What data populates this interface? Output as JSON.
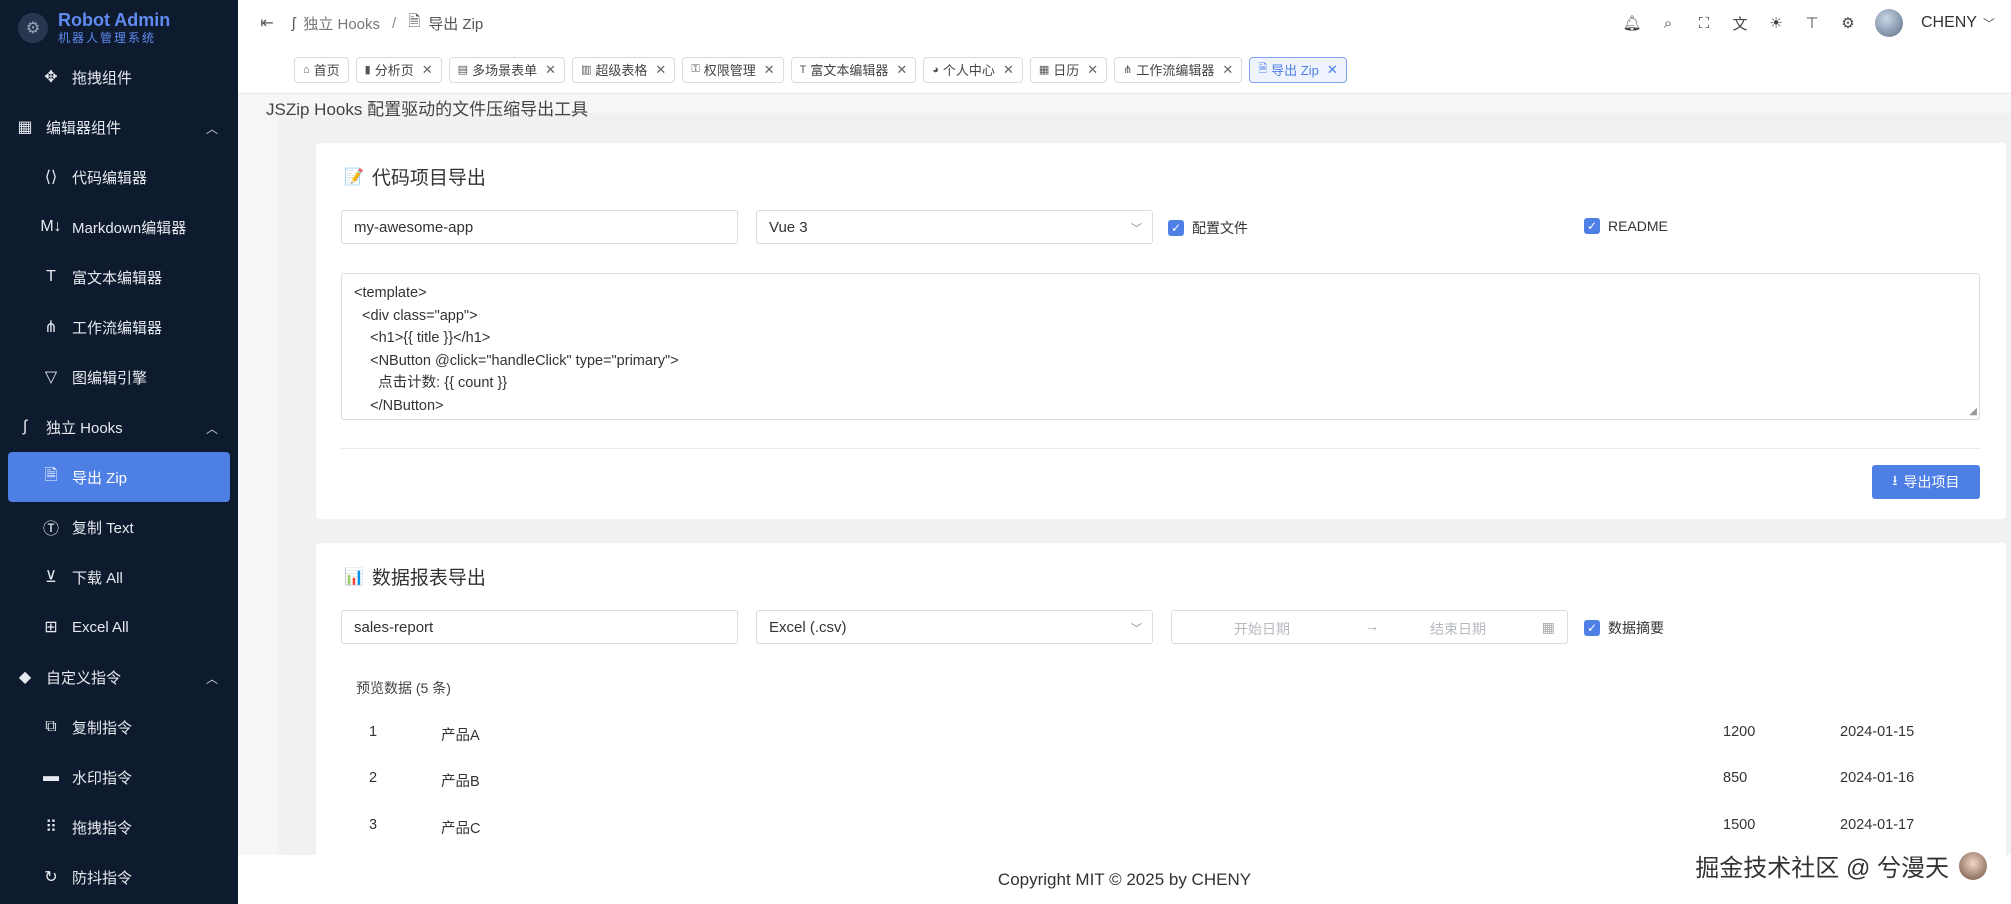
{
  "brand": {
    "title": "Robot Admin",
    "subtitle": "机器人管理系统"
  },
  "sidebar": {
    "items": [
      {
        "label": "拖拽组件",
        "icon": "drag-component-icon",
        "type": "child"
      },
      {
        "label": "编辑器组件",
        "icon": "editor-group-icon",
        "type": "group",
        "expanded": true
      },
      {
        "label": "代码编辑器",
        "icon": "vscode-icon",
        "type": "child"
      },
      {
        "label": "Markdown编辑器",
        "icon": "markdown-icon",
        "type": "child"
      },
      {
        "label": "富文本编辑器",
        "icon": "text-format-icon",
        "type": "child"
      },
      {
        "label": "工作流编辑器",
        "icon": "workflow-icon",
        "type": "child"
      },
      {
        "label": "图编辑引擎",
        "icon": "graph-engine-icon",
        "type": "child"
      },
      {
        "label": "独立 Hooks",
        "icon": "hook-icon",
        "type": "group",
        "expanded": true
      },
      {
        "label": "导出 Zip",
        "icon": "file-zip-icon",
        "type": "child",
        "active": true
      },
      {
        "label": "复制 Text",
        "icon": "text-circle-icon",
        "type": "child"
      },
      {
        "label": "下载 All",
        "icon": "download-circle-icon",
        "type": "child"
      },
      {
        "label": "Excel All",
        "icon": "excel-icon",
        "type": "child"
      },
      {
        "label": "自定义指令",
        "icon": "directive-icon",
        "type": "group",
        "expanded": true
      },
      {
        "label": "复制指令",
        "icon": "copy-icon",
        "type": "child"
      },
      {
        "label": "水印指令",
        "icon": "watermark-icon",
        "type": "child"
      },
      {
        "label": "拖拽指令",
        "icon": "drag-dots-icon",
        "type": "child"
      },
      {
        "label": "防抖指令",
        "icon": "debounce-icon",
        "type": "child"
      }
    ]
  },
  "header": {
    "breadcrumb": [
      "独立 Hooks",
      "导出 Zip"
    ],
    "username": "CHENY",
    "tools": [
      "bell-icon",
      "search-icon",
      "fullscreen-icon",
      "translate-icon",
      "theme-sun-icon",
      "layout-icon",
      "settings-icon"
    ]
  },
  "tabs": [
    {
      "label": "首页",
      "icon": "home-icon",
      "closable": false
    },
    {
      "label": "分析页",
      "icon": "chart-icon",
      "closable": true
    },
    {
      "label": "多场景表单",
      "icon": "form-icon",
      "closable": true
    },
    {
      "label": "超级表格",
      "icon": "table-icon",
      "closable": true
    },
    {
      "label": "权限管理",
      "icon": "key-icon",
      "closable": true
    },
    {
      "label": "富文本编辑器",
      "icon": "text-format-icon",
      "closable": true
    },
    {
      "label": "个人中心",
      "icon": "user-icon",
      "closable": true
    },
    {
      "label": "日历",
      "icon": "calendar-icon",
      "closable": true
    },
    {
      "label": "工作流编辑器",
      "icon": "workflow-icon",
      "closable": true
    },
    {
      "label": "导出 Zip",
      "icon": "file-zip-icon",
      "closable": true,
      "active": true
    }
  ],
  "page": {
    "clipped_intro": "JSZip Hooks 配置驱动的文件压缩导出工具"
  },
  "code_card": {
    "title": "代码项目导出",
    "emoji": "📝",
    "project_name": "my-awesome-app",
    "framework": "Vue 3",
    "checkbox_config": "配置文件",
    "checkbox_readme": "README",
    "code_lines": [
      "<template>",
      "  <div class=\"app\">",
      "    <h1>{{ title }}</h1>",
      "    <NButton @click=\"handleClick\" type=\"primary\">",
      "      点击计数: {{ count }}",
      "    </NButton>"
    ],
    "export_button": "导出项目"
  },
  "report_card": {
    "title": "数据报表导出",
    "emoji": "📊",
    "file_name": "sales-report",
    "format": "Excel (.csv)",
    "start_placeholder": "开始日期",
    "end_placeholder": "结束日期",
    "checkbox_summary": "数据摘要",
    "preview_label": "预览数据 (5 条)",
    "rows": [
      {
        "id": "1",
        "name": "产品A",
        "value": "1200",
        "date": "2024-01-15"
      },
      {
        "id": "2",
        "name": "产品B",
        "value": "850",
        "date": "2024-01-16"
      },
      {
        "id": "3",
        "name": "产品C",
        "value": "1500",
        "date": "2024-01-17"
      }
    ]
  },
  "footer": {
    "copyright": "Copyright MIT © 2025 by CHENY"
  },
  "watermark": {
    "text": "掘金技术社区 @ 兮漫天"
  },
  "colors": {
    "sidebar_bg": "#0e1a2d",
    "accent": "#4e7fe5",
    "brand_text": "#5f8bf0"
  }
}
